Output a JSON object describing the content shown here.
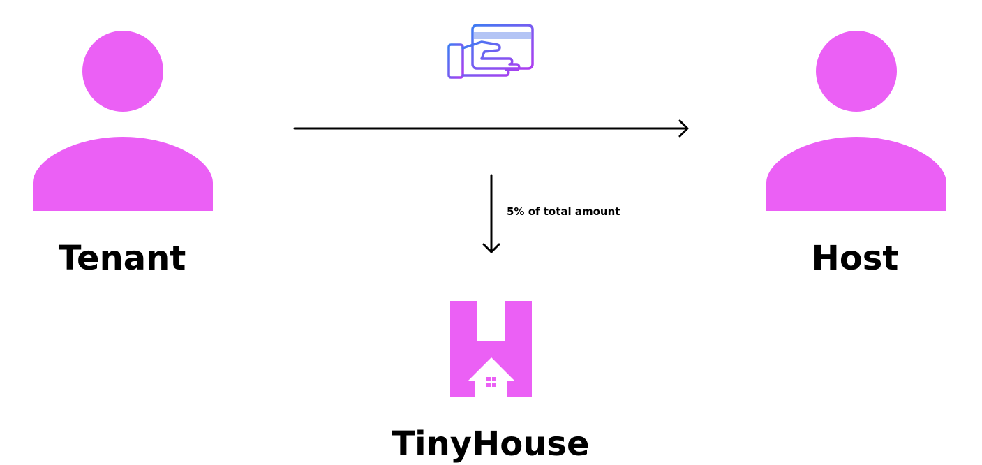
{
  "nodes": {
    "tenant": {
      "label": "Tenant",
      "icon": "person-icon"
    },
    "host": {
      "label": "Host",
      "icon": "person-icon"
    },
    "platform": {
      "label": "TinyHouse",
      "icon": "tinyhouse-logo-icon"
    }
  },
  "edges": {
    "payment": {
      "from": "tenant",
      "to": "host",
      "icon": "card-payment-icon"
    },
    "fee": {
      "from": "payment",
      "to": "platform",
      "label": "5% of total amount"
    }
  },
  "colors": {
    "person": "#eb60f5",
    "logo": "#eb60f5",
    "arrow": "#000000",
    "card_gradient_start": "#3d7cf2",
    "card_gradient_end": "#b03cf0",
    "card_stripe": "#b3c4f5"
  }
}
